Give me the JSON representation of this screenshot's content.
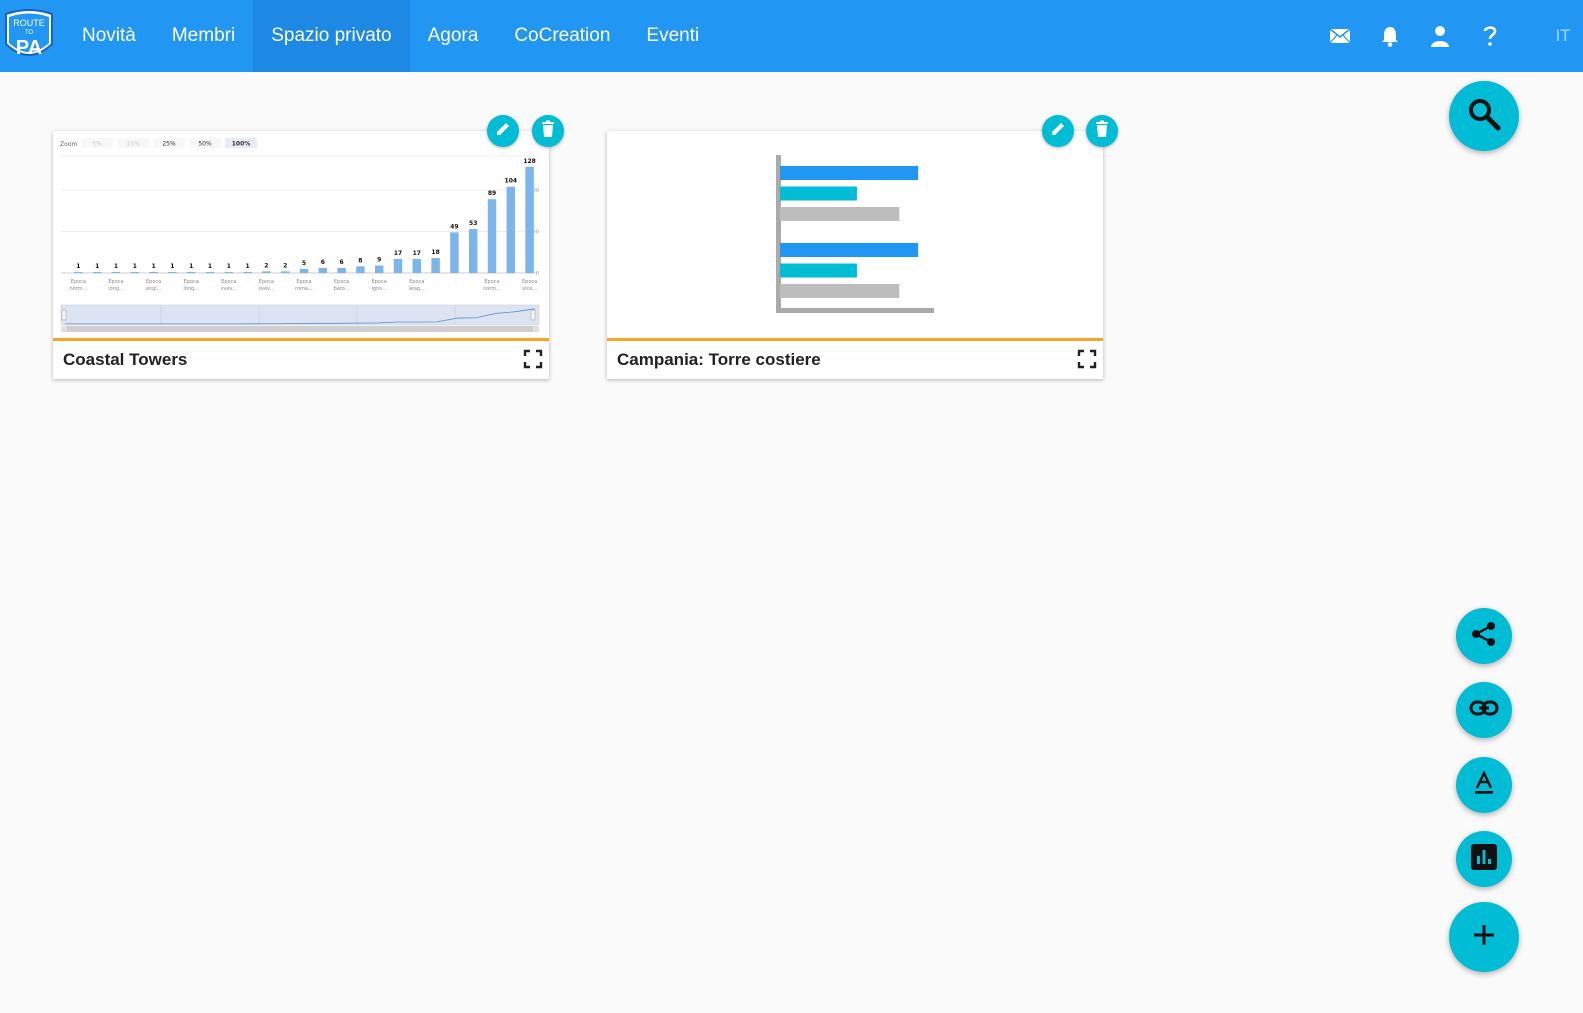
{
  "header": {
    "logo": {
      "line1": "ROUTE",
      "line2": "TO",
      "line3": "PA"
    },
    "nav": [
      {
        "label": "Novità"
      },
      {
        "label": "Membri"
      },
      {
        "label": "Spazio privato"
      },
      {
        "label": "Agora"
      },
      {
        "label": "CoCreation"
      },
      {
        "label": "Eventi"
      }
    ],
    "active_nav": "Spazio privato",
    "icons": [
      "mail-icon",
      "bell-icon",
      "user-icon",
      "help-icon"
    ],
    "language": "IT"
  },
  "cards": [
    {
      "title": "Coastal Towers"
    },
    {
      "title": "Campania: Torre costiere"
    }
  ],
  "chart_data": [
    {
      "type": "bar",
      "zoom_label": "Zoom",
      "zoom_options": [
        "5%",
        "15%",
        "25%",
        "50%",
        "100%"
      ],
      "zoom_selected": "100%",
      "values": [
        1,
        1,
        1,
        1,
        1,
        1,
        1,
        1,
        1,
        1,
        2,
        2,
        5,
        6,
        6,
        8,
        9,
        17,
        17,
        18,
        49,
        53,
        89,
        104,
        128
      ],
      "value_labels": [
        "1",
        "1",
        "1",
        "1",
        "1",
        "1",
        "1",
        "1",
        "1",
        "1",
        "2",
        "2",
        "5",
        "6",
        "6",
        "8",
        "9",
        "17",
        "17",
        "18",
        "49",
        "53",
        "89",
        "104",
        "128"
      ],
      "x_tick_labels": [
        [
          "Epoca",
          "norm..."
        ],
        [
          "Epoca",
          "long..."
        ],
        [
          "Epoca",
          "angi..."
        ],
        [
          "Epoca",
          "long..."
        ],
        [
          "Epoca",
          "svev..."
        ],
        [
          "Epoca",
          "svev..."
        ],
        [
          "Epoca",
          "roma..."
        ],
        [
          "Epoca",
          "baro..."
        ],
        [
          "Epoca",
          "igno..."
        ],
        [
          "Epoca",
          "arag..."
        ],
        [
          "Epoca",
          "norm..."
        ],
        [
          "Epoca",
          "vice..."
        ]
      ],
      "y_ticks": [
        "100",
        "50",
        "0"
      ],
      "ylim": [
        0,
        135
      ],
      "bar_color": "#7cb5ec"
    },
    {
      "type": "bar",
      "orientation": "horizontal",
      "groups": [
        {
          "values": [
            0.88,
            0.49,
            0.76
          ],
          "colors": [
            "#2196f3",
            "#00bcd4",
            "#bdbdbd"
          ]
        },
        {
          "values": [
            0.88,
            0.49,
            0.76
          ],
          "colors": [
            "#2196f3",
            "#00bcd4",
            "#bdbdbd"
          ]
        }
      ]
    }
  ],
  "fabs": {
    "search": "search-icon",
    "share": "share-icon",
    "link": "link-icon",
    "text": "text-format-icon",
    "chart": "chart-icon",
    "add": "add-icon"
  },
  "colors": {
    "header": "#2196f3",
    "active_nav": "#1e88e5",
    "accent": "#00bcd4",
    "card_divider": "#f5a623",
    "background": "#fafafa"
  }
}
